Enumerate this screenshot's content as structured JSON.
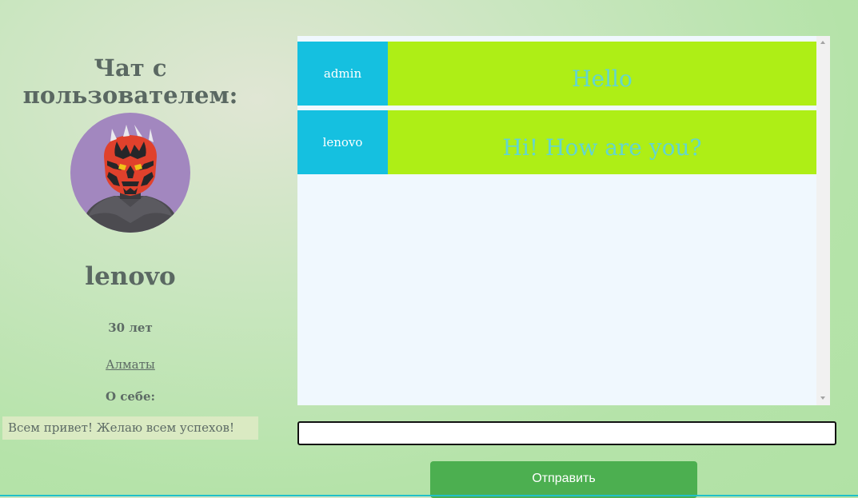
{
  "profile": {
    "chat_title": "Чат с пользователем:",
    "username": "lenovo",
    "age": "30 лет",
    "city": "Алматы",
    "about_label": "О себе:",
    "about_text": "Всем привет! Желаю всем успехов!",
    "avatar_icon": "darth-maul-avatar-icon"
  },
  "chat": {
    "messages": [
      {
        "author": "admin",
        "text": "Hello"
      },
      {
        "author": "lenovo",
        "text": "Hi! How are you?"
      }
    ]
  },
  "composer": {
    "input_value": "",
    "send_label": "Отправить"
  },
  "colors": {
    "author_bg": "#15c0e0",
    "message_bg": "#aeee16",
    "message_text": "#63d5cf",
    "send_button": "#4caf50",
    "avatar_bg": "#a287bf"
  }
}
